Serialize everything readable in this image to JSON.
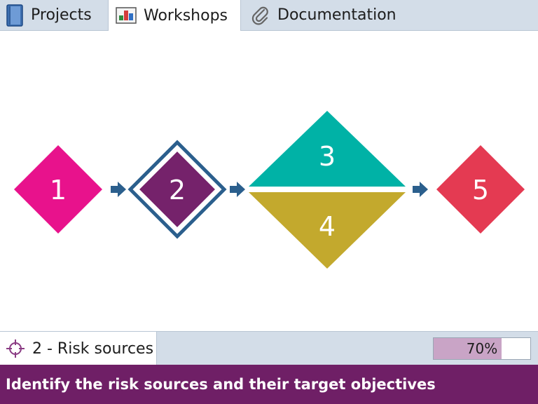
{
  "tabs": [
    {
      "label": "Projects",
      "icon": "book-icon",
      "active": false
    },
    {
      "label": "Workshops",
      "icon": "workshop-icon",
      "active": true
    },
    {
      "label": "Documentation",
      "icon": "paperclip-icon",
      "active": false
    }
  ],
  "workflow": {
    "steps": [
      {
        "number": "1",
        "color": "#e8128c"
      },
      {
        "number": "2",
        "color": "#75226b",
        "selected": true,
        "outline_color": "#2b5f8d"
      },
      {
        "number": "3",
        "color": "#00b2a6"
      },
      {
        "number": "4",
        "color": "#c3a92d"
      },
      {
        "number": "5",
        "color": "#e43a52"
      }
    ],
    "arrow_color": "#2b5f8d"
  },
  "status": {
    "current_step": "2 - Risk sources",
    "step_icon": "crosshair-icon",
    "progress_text": "70%",
    "progress_value": 0.7,
    "progress_color": "#c9a4c6"
  },
  "footer": {
    "text": "Identify the risk sources and their target objectives",
    "color": "#6f1f66"
  }
}
